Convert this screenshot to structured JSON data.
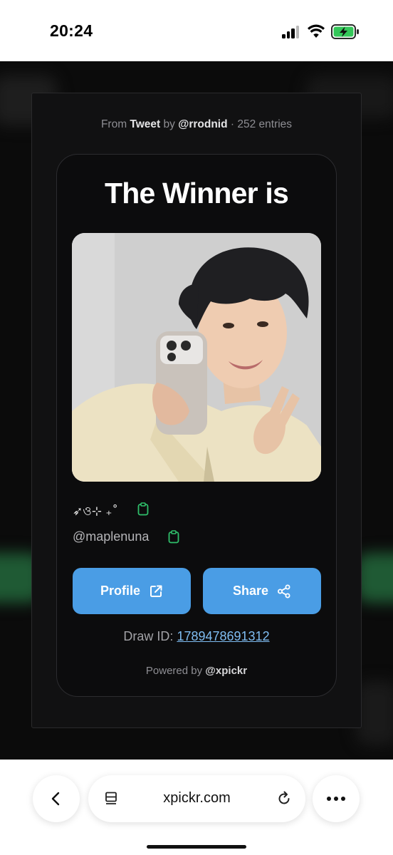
{
  "status_bar": {
    "time": "20:24"
  },
  "modal": {
    "source": {
      "prefix": "From",
      "platform": "Tweet",
      "by": "by",
      "author": "@rrodnid",
      "separator": "·",
      "entries": "252 entries"
    },
    "title": "The Winner is",
    "winner": {
      "name": "➶ও⊹ ₊˚",
      "handle": "@maplenuna"
    },
    "buttons": {
      "profile": "Profile",
      "share": "Share"
    },
    "draw": {
      "label": "Draw ID:",
      "id": "1789478691312"
    },
    "powered": {
      "prefix": "Powered by",
      "brand": "@xpickr"
    }
  },
  "browser": {
    "url": "xpickr.com"
  },
  "colors": {
    "accent": "#4a9de5",
    "link": "#7fbdf2",
    "copy_icon": "#2fbf6a",
    "card_bg": "#0c0c0d"
  },
  "icons": [
    "signal-icon",
    "wifi-icon",
    "battery-charging-icon",
    "copy-icon",
    "external-link-icon",
    "share-icon",
    "back-icon",
    "tabs-icon",
    "reload-icon",
    "more-icon"
  ]
}
